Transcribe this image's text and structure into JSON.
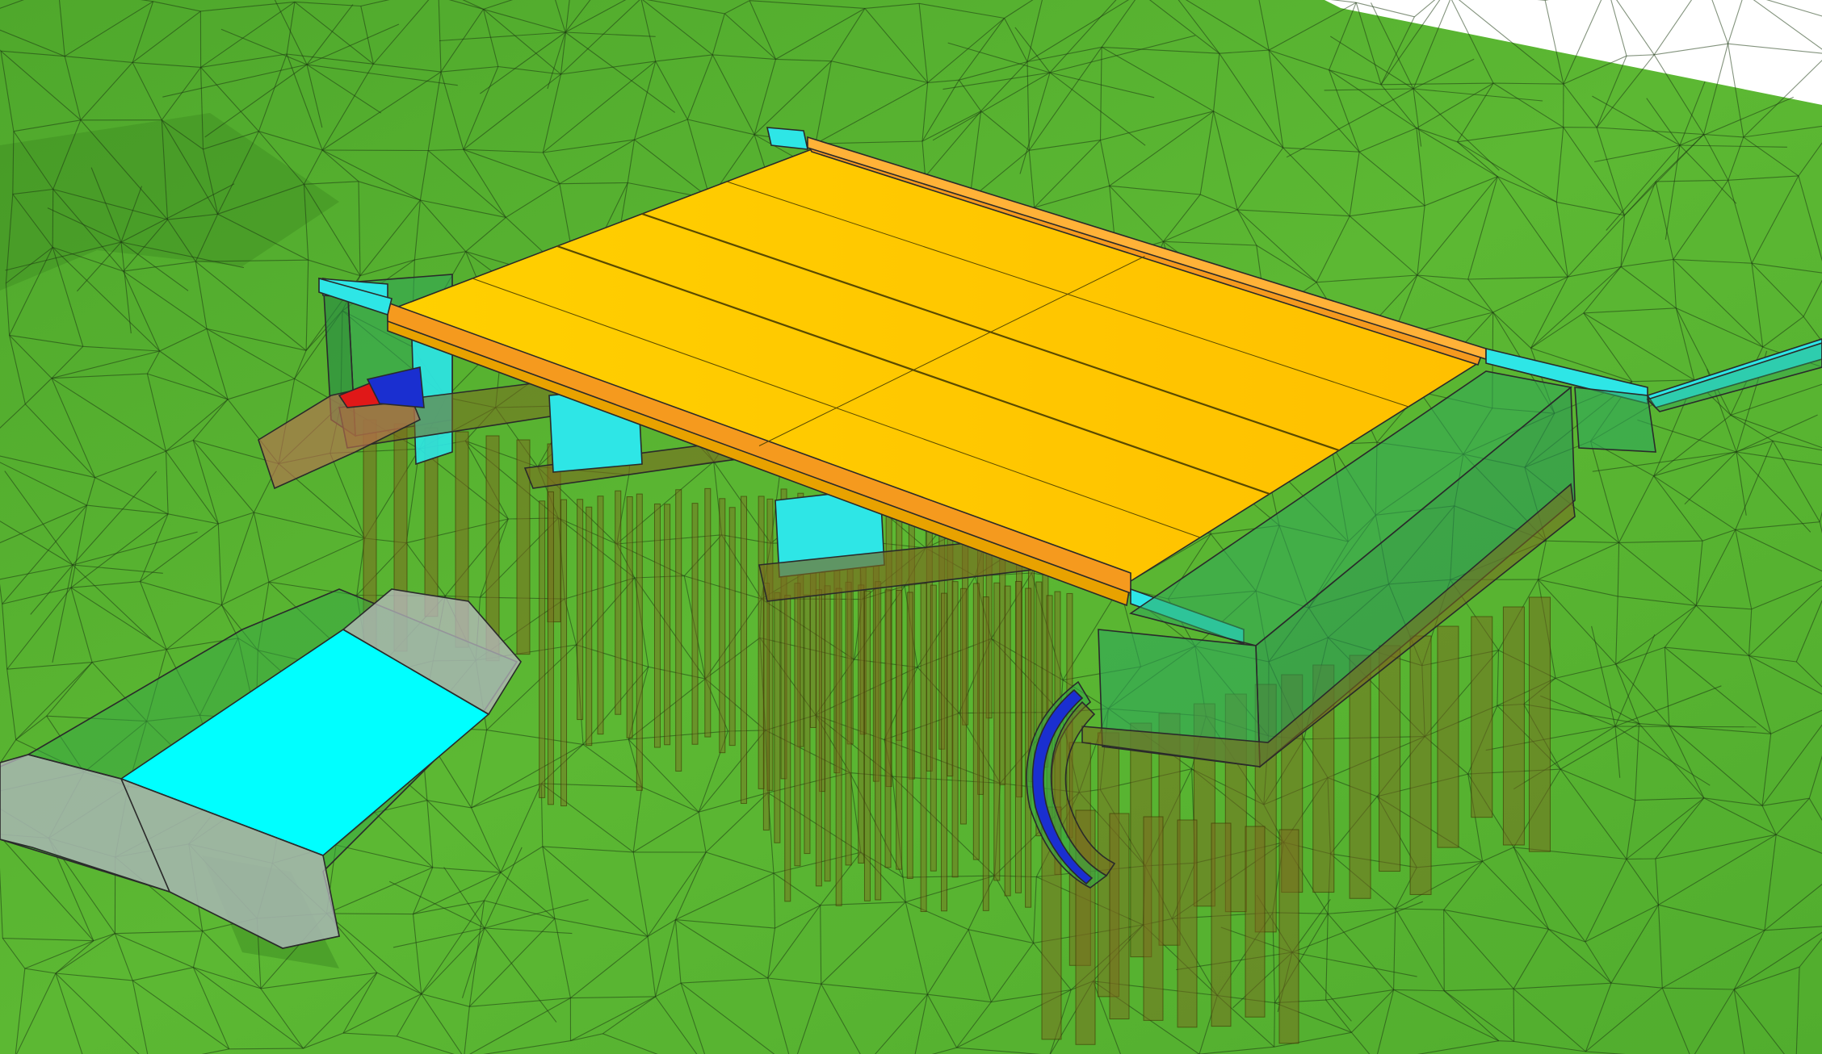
{
  "scene": {
    "colors": {
      "terrain": "#56b231",
      "terrain_dark": "#3f8f22",
      "mesh_line": "#1e3a12",
      "sky": "#ffffff",
      "deck": "#ffc800",
      "deck_edge": "#e8a200",
      "parapet": "#f59a1e",
      "cap_beam": "#2ee6e6",
      "abutment_glass": "#2fa85a",
      "pile": "#7a6a1e",
      "pond_water": "#00ffff",
      "pond_wall": "#b8b8c0",
      "wing_blue": "#1a2fd0",
      "wing_red": "#e01818",
      "pipe_brown": "#b87050"
    },
    "components": [
      "terrain-mesh",
      "bridge-deck",
      "parapet-north",
      "parapet-south",
      "abutment-west",
      "abutment-east",
      "pier-cap",
      "piles",
      "retention-pond",
      "drainage-channel",
      "curved-wingwall"
    ]
  }
}
